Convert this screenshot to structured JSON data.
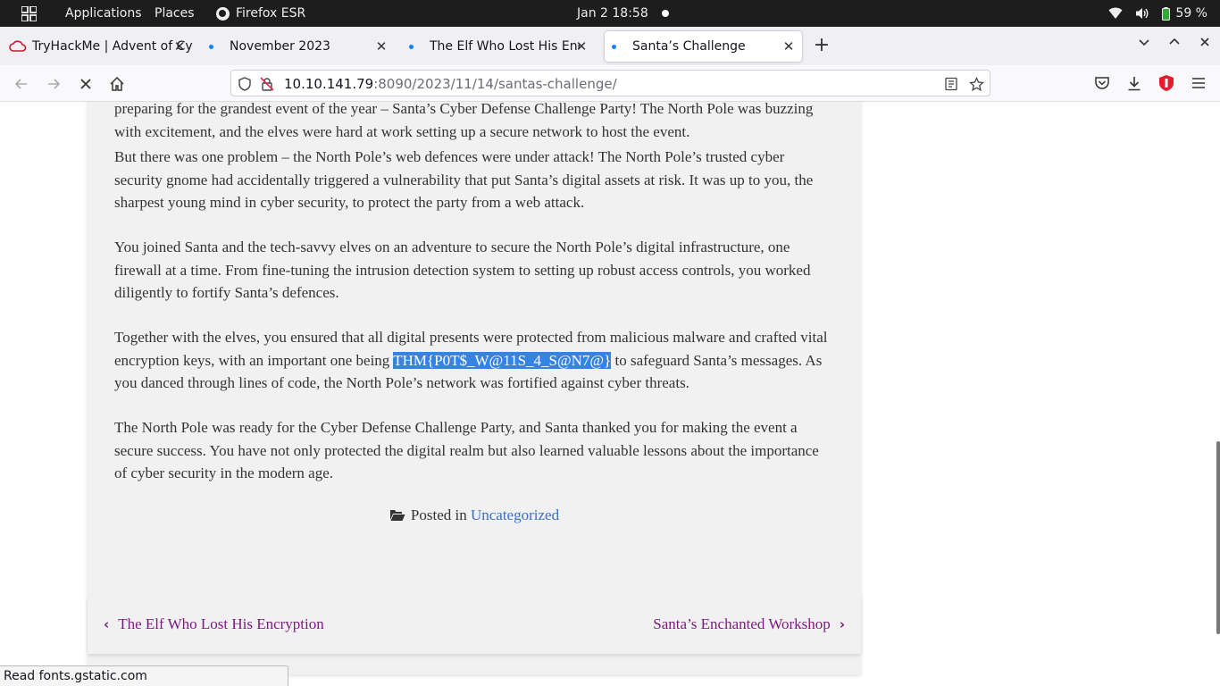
{
  "topbar": {
    "applications": "Applications",
    "places": "Places",
    "active_app": "Firefox ESR",
    "clock": "Jan 2  18:58",
    "battery": "59 %"
  },
  "tabs": [
    {
      "title": "TryHackMe | Advent of Cy",
      "icon": "tryhackme-cloud-icon"
    },
    {
      "title": "November 2023"
    },
    {
      "title": "The Elf Who Lost His Encr"
    },
    {
      "title": "Santa’s Challenge",
      "active": true
    }
  ],
  "url": {
    "host": "10.10.141.79",
    "rest": ":8090/2023/11/14/santas-challenge/"
  },
  "article": {
    "p1": "preparing for the grandest event of the year – Santa’s Cyber Defense Challenge Party! The North Pole was buzzing with excitement, and the elves were hard at work setting up a secure network to host the event.",
    "p2": "But there was one problem – the North Pole’s web defences were under attack! The North Pole’s trusted cyber security gnome had accidentally triggered a vulnerability that put Santa’s digital assets at risk. It was up to you, the sharpest young mind in cyber security, to protect the party from a web attack.",
    "p3": "You joined Santa and the tech-savvy elves on an adventure to secure the North Pole’s digital infrastructure, one firewall at a time. From fine-tuning the intrusion detection system to setting up robust access controls, you worked diligently to fortify Santa’s defences.",
    "p4_before": "Together with the elves, you ensured that all digital presents were protected from malicious malware and crafted vital encryption keys, with an important one being ",
    "p4_flag": "THM{P0T$_W@11S_4_S@N7@}",
    "p4_after": " to safeguard Santa’s messages. As you danced through lines of code, the North Pole’s network was fortified against cyber threats.",
    "p5": "The North Pole was ready for the Cyber Defense Challenge Party, and Santa thanked you for making the event a secure success. You have not only protected the digital realm but also learned valuable lessons about the importance of cyber security in the modern age.",
    "posted_in": "Posted in",
    "category": "Uncategorized"
  },
  "post_nav": {
    "prev": "The Elf Who Lost His Encryption",
    "next": "Santa’s Enchanted Workshop"
  },
  "status": "Read fonts.gstatic.com",
  "colors": {
    "flag_highlight": "#3584e4",
    "nav_link": "#7a1a7d",
    "category_link": "#3a6ec6",
    "pocket_red": "#e51c2d"
  }
}
